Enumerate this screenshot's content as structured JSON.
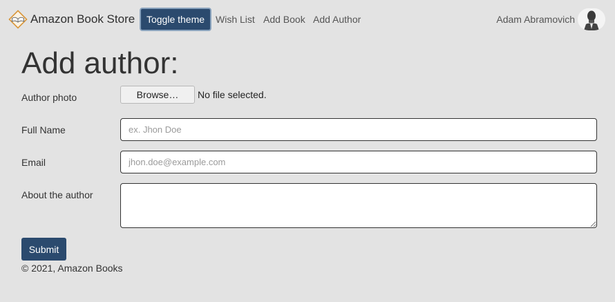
{
  "navbar": {
    "brand": "Amazon Book Store",
    "brand_icon": "open-book-diamond-icon",
    "toggle_label": "Toggle theme",
    "links": [
      "Wish List",
      "Add Book",
      "Add Author"
    ],
    "user_name": "Adam Abramovich",
    "avatar_icon": "user-avatar-icon"
  },
  "main": {
    "title": "Add author:",
    "photo": {
      "label": "Author photo",
      "browse_label": "Browse…",
      "status": "No file selected."
    },
    "full_name": {
      "label": "Full Name",
      "value": "",
      "placeholder": "ex. Jhon Doe"
    },
    "email": {
      "label": "Email",
      "value": "",
      "placeholder": "jhon.doe@example.com"
    },
    "about": {
      "label": "About the author",
      "value": ""
    },
    "submit_label": "Submit"
  },
  "footer": {
    "text": "© 2021, Amazon Books"
  },
  "colors": {
    "page_bg": "#e3e3e3",
    "primary": "#2b4a6e",
    "logo_accent": "#e0a040"
  }
}
